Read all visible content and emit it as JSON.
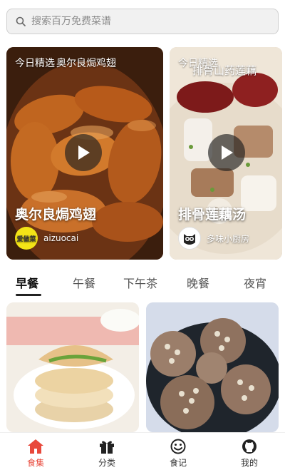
{
  "search": {
    "placeholder": "搜索百万免费菜谱"
  },
  "featured": [
    {
      "tag": "今日精选",
      "overlay_title": "奥尔良焗鸡翅",
      "title": "奥尔良焗鸡翅",
      "author": "aizuocai",
      "avatar_text": "爱做菜"
    },
    {
      "tag": "今日精选",
      "overlay_title": "排骨山药莲藕",
      "title": "排骨莲藕汤",
      "author": "多味小厨房"
    }
  ],
  "tabs": [
    "早餐",
    "午餐",
    "下午茶",
    "晚餐",
    "夜宵"
  ],
  "active_tab": "早餐",
  "bottom_nav": [
    {
      "label": "食集",
      "icon": "home-icon",
      "active": true
    },
    {
      "label": "分类",
      "icon": "gift-icon",
      "active": false
    },
    {
      "label": "食记",
      "icon": "smiley-icon",
      "active": false
    },
    {
      "label": "我的",
      "icon": "github-icon",
      "active": false
    }
  ],
  "colors": {
    "accent": "#e8483b",
    "text_dark": "#111111",
    "text_muted": "#555555"
  }
}
